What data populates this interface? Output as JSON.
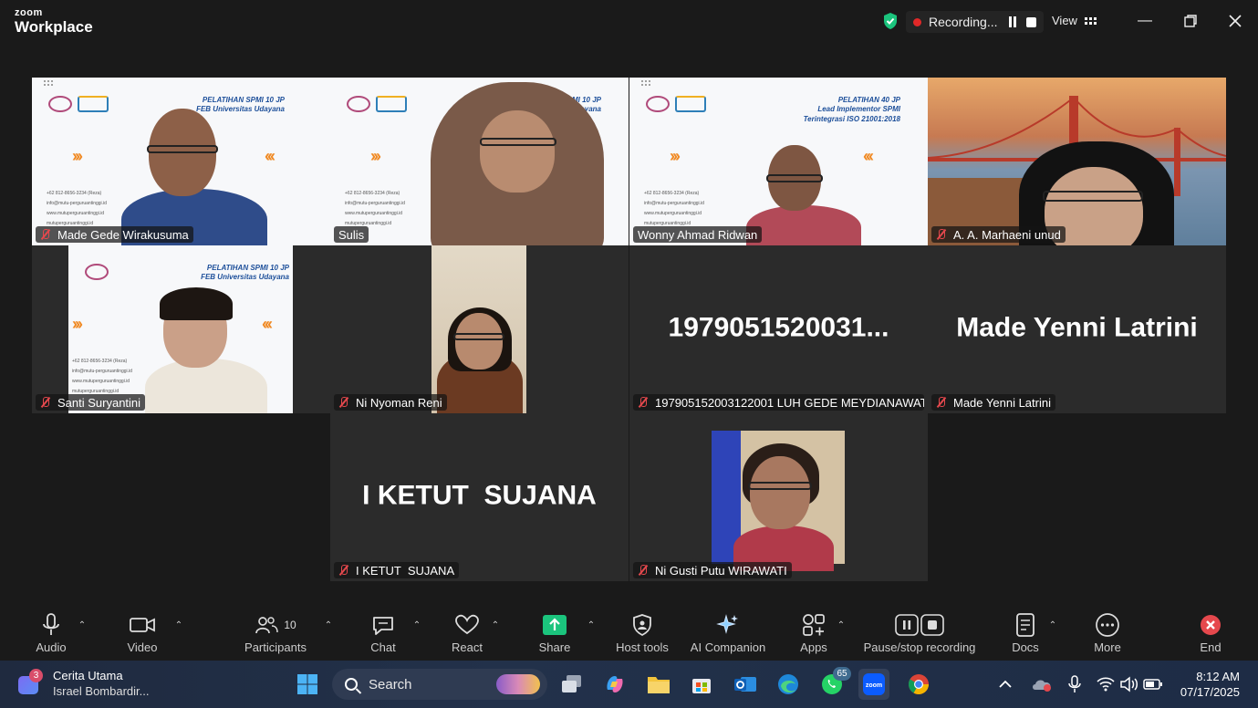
{
  "app": {
    "brand_top": "zoom",
    "brand_name": "Workplace"
  },
  "titlebar": {
    "recording_label": "Recording...",
    "view_label": "View"
  },
  "tiles": [
    {
      "name": "Made Gede Wirakusuma",
      "muted": true,
      "slide_heading": "PELATIHAN SPMI 10 JP\nFEB Universitas Udayana"
    },
    {
      "name": "Sulis",
      "muted": false,
      "active": true,
      "slide_heading": "PELATIHAN SPMI 10 JP\nFEB Universitas Udayana"
    },
    {
      "name": "Wonny Ahmad Ridwan",
      "muted": false,
      "slide_heading": "PELATIHAN 40 JP\nLead Implementor SPMI\nTerintegrasi ISO 21001:2018"
    },
    {
      "name": "A. A. Marhaeni unud",
      "muted": true
    },
    {
      "name": "Santi Suryantini",
      "muted": true,
      "slide_heading": "PELATIHAN SPMI 10 JP\nFEB Universitas Udayana"
    },
    {
      "name": "Ni Nyoman Reni",
      "muted": true
    },
    {
      "name": "197905152003122001 LUH GEDE MEYDIANAWAT...",
      "muted": true,
      "display": "1979051520031..."
    },
    {
      "name": "Made Yenni Latrini",
      "muted": true,
      "display": "Made Yenni Latrini"
    },
    {
      "name": "I KETUT  SUJANA",
      "muted": true,
      "display": "I KETUT  SUJANA"
    },
    {
      "name": "Ni Gusti Putu WIRAWATI",
      "muted": true
    }
  ],
  "slide_contacts": "+62 812-8656-3234 (Reza)\ninfo@mutu-perguruantinggi.id\nwww.mutuperguruantinggi.id\nmutuperguruantinggi.id",
  "toolbar": {
    "audio": "Audio",
    "video": "Video",
    "participants": "Participants",
    "participants_count": "10",
    "chat": "Chat",
    "react": "React",
    "share": "Share",
    "host_tools": "Host tools",
    "ai_companion": "AI Companion",
    "apps": "Apps",
    "pause_stop": "Pause/stop recording",
    "docs": "Docs",
    "more": "More",
    "end": "End"
  },
  "taskbar": {
    "news_badge": "3",
    "news_title": "Cerita Utama",
    "news_sub": "Israel Bombardir...",
    "search_placeholder": "Search",
    "whatsapp_badge": "65",
    "time": "8:12 AM",
    "date": "07/17/2025"
  },
  "colors": {
    "accent_green": "#3ed4a7",
    "mute_red": "#e5484d",
    "end_red": "#e5484d",
    "share_green": "#1bc47d"
  }
}
